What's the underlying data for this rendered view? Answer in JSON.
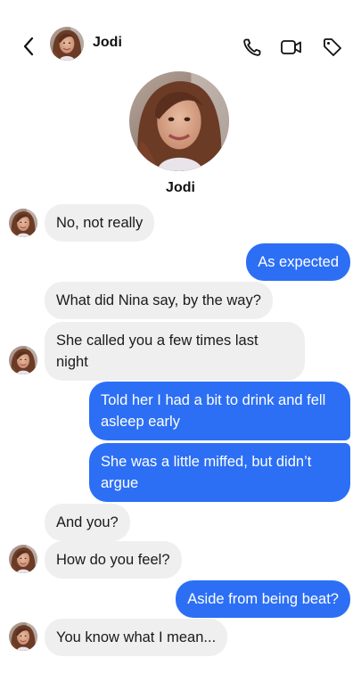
{
  "header": {
    "name": "Jodi"
  },
  "profile": {
    "name": "Jodi"
  },
  "messages": [
    {
      "from": "them",
      "text": "No, not really"
    },
    {
      "from": "me",
      "text": "As expected"
    },
    {
      "from": "them",
      "text": "What did Nina say, by the way?"
    },
    {
      "from": "them",
      "text": "She called you a few times last night"
    },
    {
      "from": "me",
      "text": "Told her I had a bit to drink and fell asleep early"
    },
    {
      "from": "me",
      "text": "She was a little miffed, but didn’t argue"
    },
    {
      "from": "them",
      "text": "And you?"
    },
    {
      "from": "them",
      "text": "How do you feel?"
    },
    {
      "from": "me",
      "text": "Aside from being beat?"
    },
    {
      "from": "them",
      "text": "You know what I mean..."
    }
  ],
  "icons": {
    "back": "chevron-left-icon",
    "call": "phone-icon",
    "video": "video-camera-icon",
    "tag": "tag-icon"
  },
  "colors": {
    "outgoing_bubble": "#2c6ff5",
    "incoming_bubble": "#efefef",
    "text": "#111111"
  }
}
